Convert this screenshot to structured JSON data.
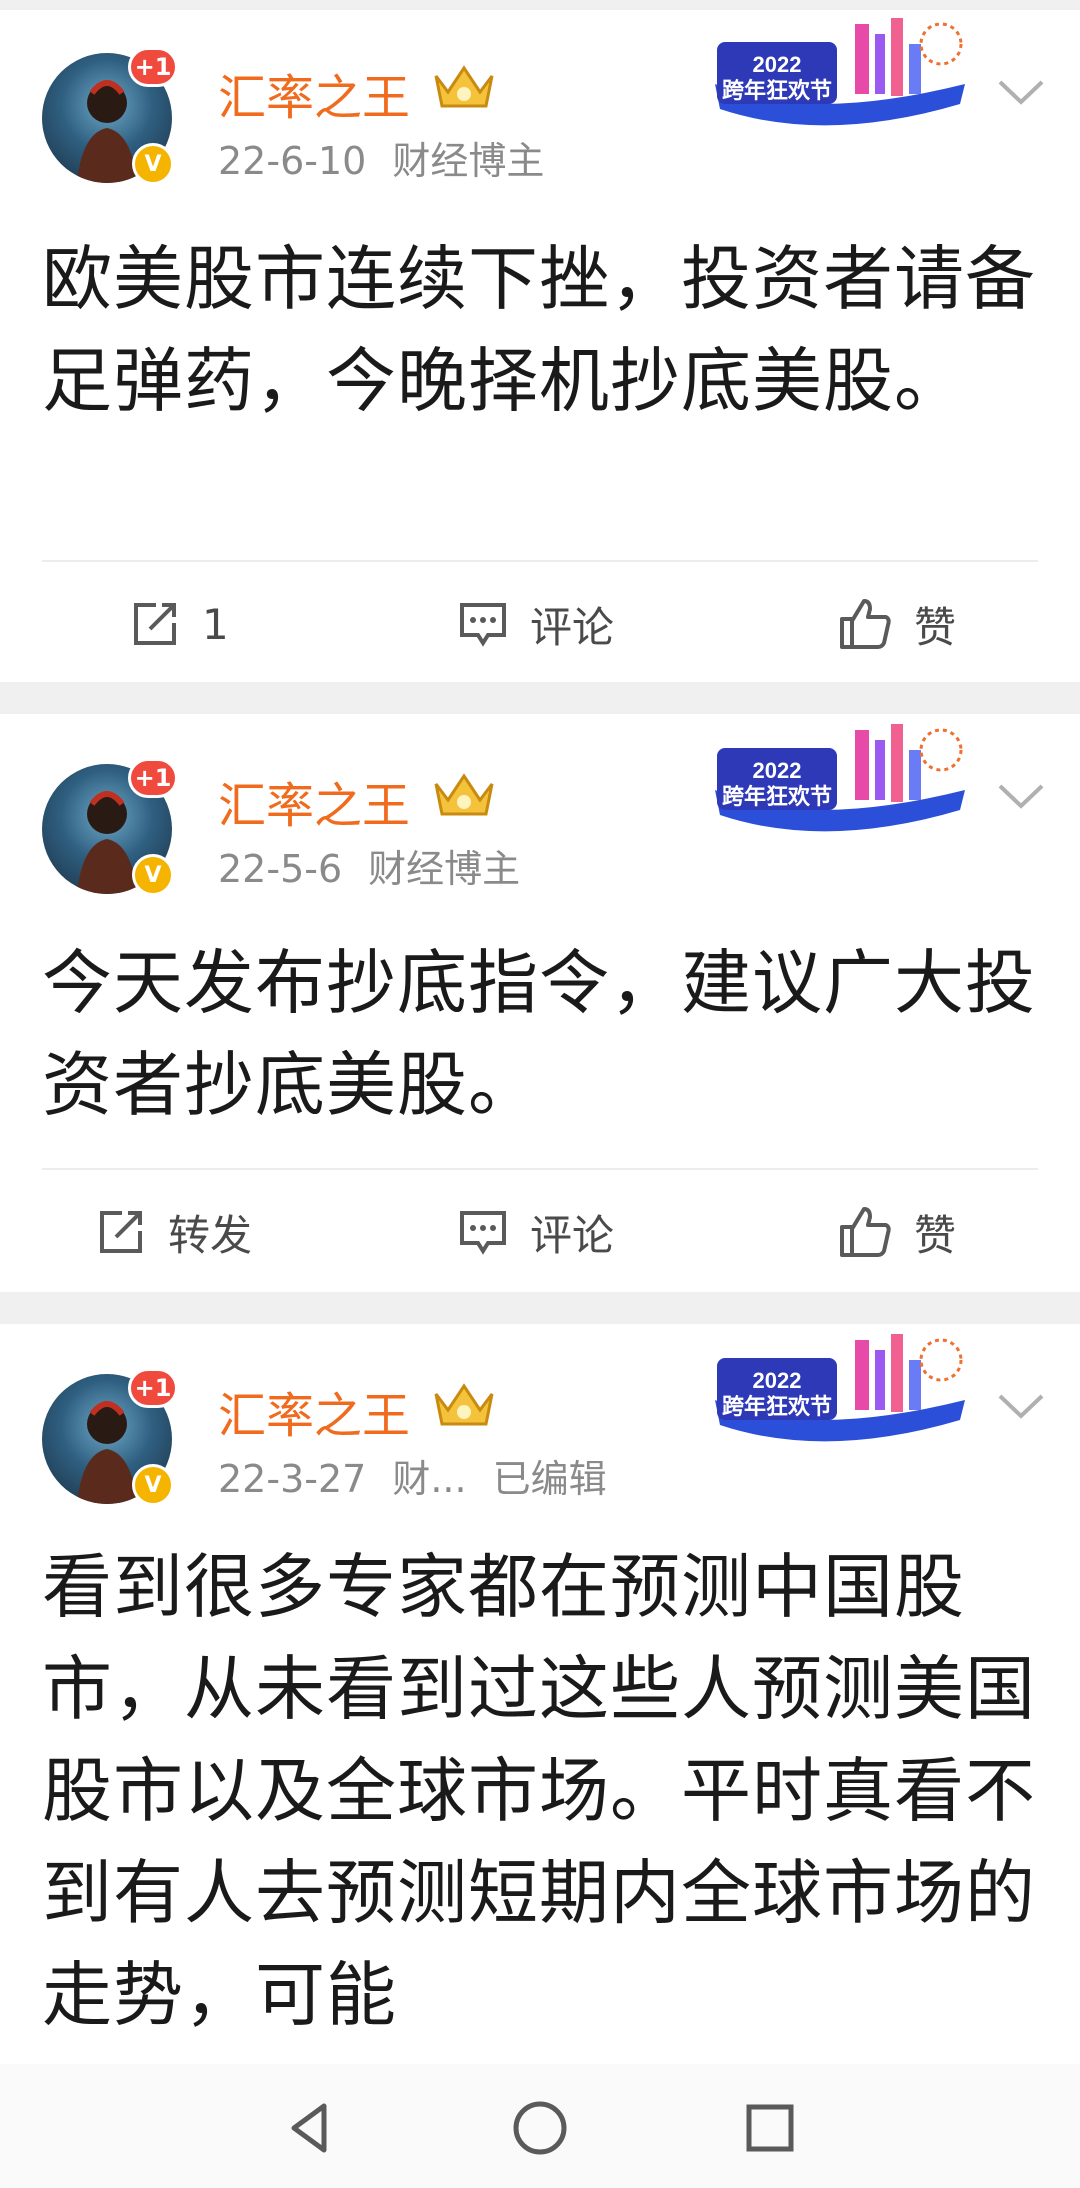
{
  "posts": [
    {
      "username": "汇率之王",
      "plus_badge": "+1",
      "date": "22-6-10",
      "tag": "财经博主",
      "edited": "",
      "content": "欧美股市连续下挫，投资者请备足弹药，今晚择机抄底美股。",
      "repost_label": "1",
      "comment_label": "评论",
      "like_label": "赞",
      "banner_text": "2022 跨年狂欢节"
    },
    {
      "username": "汇率之王",
      "plus_badge": "+1",
      "date": "22-5-6",
      "tag": "财经博主",
      "edited": "",
      "content": "今天发布抄底指令，建议广大投资者抄底美股。",
      "repost_label": "转发",
      "comment_label": "评论",
      "like_label": "赞",
      "banner_text": "2022 跨年狂欢节"
    },
    {
      "username": "汇率之王",
      "plus_badge": "+1",
      "date": "22-3-27",
      "tag": "财...",
      "edited": "已编辑",
      "content": "看到很多专家都在预测中国股市，从未看到过这些人预测美国股市以及全球市场。平时真看不到有人去预测短期内全球市场的走势，可能",
      "banner_text": "2022 跨年狂欢节"
    }
  ],
  "nav": {
    "back_icon": "back-triangle-icon",
    "home_icon": "home-circle-icon",
    "recents_icon": "recents-square-icon"
  },
  "colors": {
    "username": "#f06b1d",
    "badge_red": "#f04a3e",
    "verified": "#f5b400",
    "separator": "#f0f0f0"
  }
}
